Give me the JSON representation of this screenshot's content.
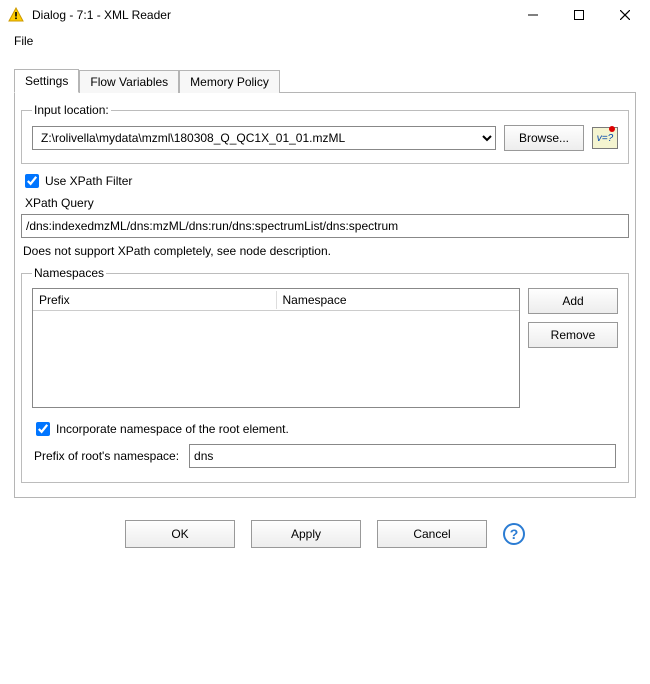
{
  "window": {
    "title": "Dialog - 7:1 - XML Reader"
  },
  "menubar": {
    "file": "File"
  },
  "tabs": {
    "settings": "Settings",
    "flow_variables": "Flow Variables",
    "memory_policy": "Memory Policy"
  },
  "input_location": {
    "legend": "Input location:",
    "value": "Z:\\rolivella\\mydata\\mzml\\180308_Q_QC1X_01_01.mzML",
    "browse_label": "Browse...",
    "var_icon_text": "v=?"
  },
  "xpath": {
    "checkbox_label": "Use XPath Filter",
    "checked": true,
    "query_label": "XPath Query",
    "query_value": "/dns:indexedmzML/dns:mzML/dns:run/dns:spectrumList/dns:spectrum",
    "hint": "Does not support XPath completely, see node description."
  },
  "namespaces": {
    "legend": "Namespaces",
    "col_prefix": "Prefix",
    "col_namespace": "Namespace",
    "add_label": "Add",
    "remove_label": "Remove",
    "incorporate_label": "Incorporate namespace of the root element.",
    "incorporate_checked": true,
    "root_prefix_label": "Prefix of root's namespace:",
    "root_prefix_value": "dns"
  },
  "footer": {
    "ok": "OK",
    "apply": "Apply",
    "cancel": "Cancel",
    "help": "?"
  }
}
